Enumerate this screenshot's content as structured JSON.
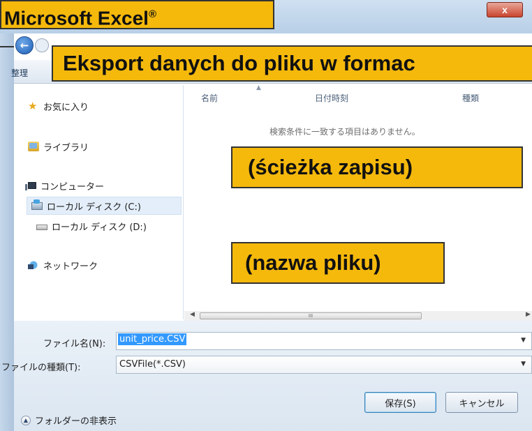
{
  "window": {
    "close_label": "x",
    "organize_label": "整理"
  },
  "annotations": {
    "app_name": "Microsoft Excel",
    "app_mark": "®",
    "export_caption": "Eksport danych do pliku w formac",
    "path_caption": "(ścieżka zapisu)",
    "filename_caption": "(nazwa pliku)"
  },
  "nav": {
    "items": [
      {
        "label": "お気に入り",
        "icon": "star-icon"
      },
      {
        "label": "ライブラリ",
        "icon": "library-icon"
      },
      {
        "label": "コンピューター",
        "icon": "computer-icon"
      },
      {
        "label": "ローカル ディスク (C:)",
        "icon": "drive-c-icon",
        "selected": true
      },
      {
        "label": "ローカル ディスク (D:)",
        "icon": "drive-d-icon"
      },
      {
        "label": "ネットワーク",
        "icon": "network-icon"
      }
    ]
  },
  "file_list": {
    "columns": [
      "名前",
      "日付時刻",
      "種類"
    ],
    "empty_message": "検索条件に一致する項目はありません。",
    "scroll_thumb_grip": "III"
  },
  "form": {
    "filename_label": "ファイル名(N):",
    "filename_value": "unit_price.CSV",
    "filetype_label": "ファイルの種類(T):",
    "filetype_value": "CSVFile(*.CSV)",
    "folder_toggle_label": "フォルダーの非表示",
    "save_label": "保存(S)",
    "cancel_label": "キャンセル"
  },
  "colors": {
    "annotation_fill": "#f5b90c",
    "selection_blue": "#3399ff"
  }
}
